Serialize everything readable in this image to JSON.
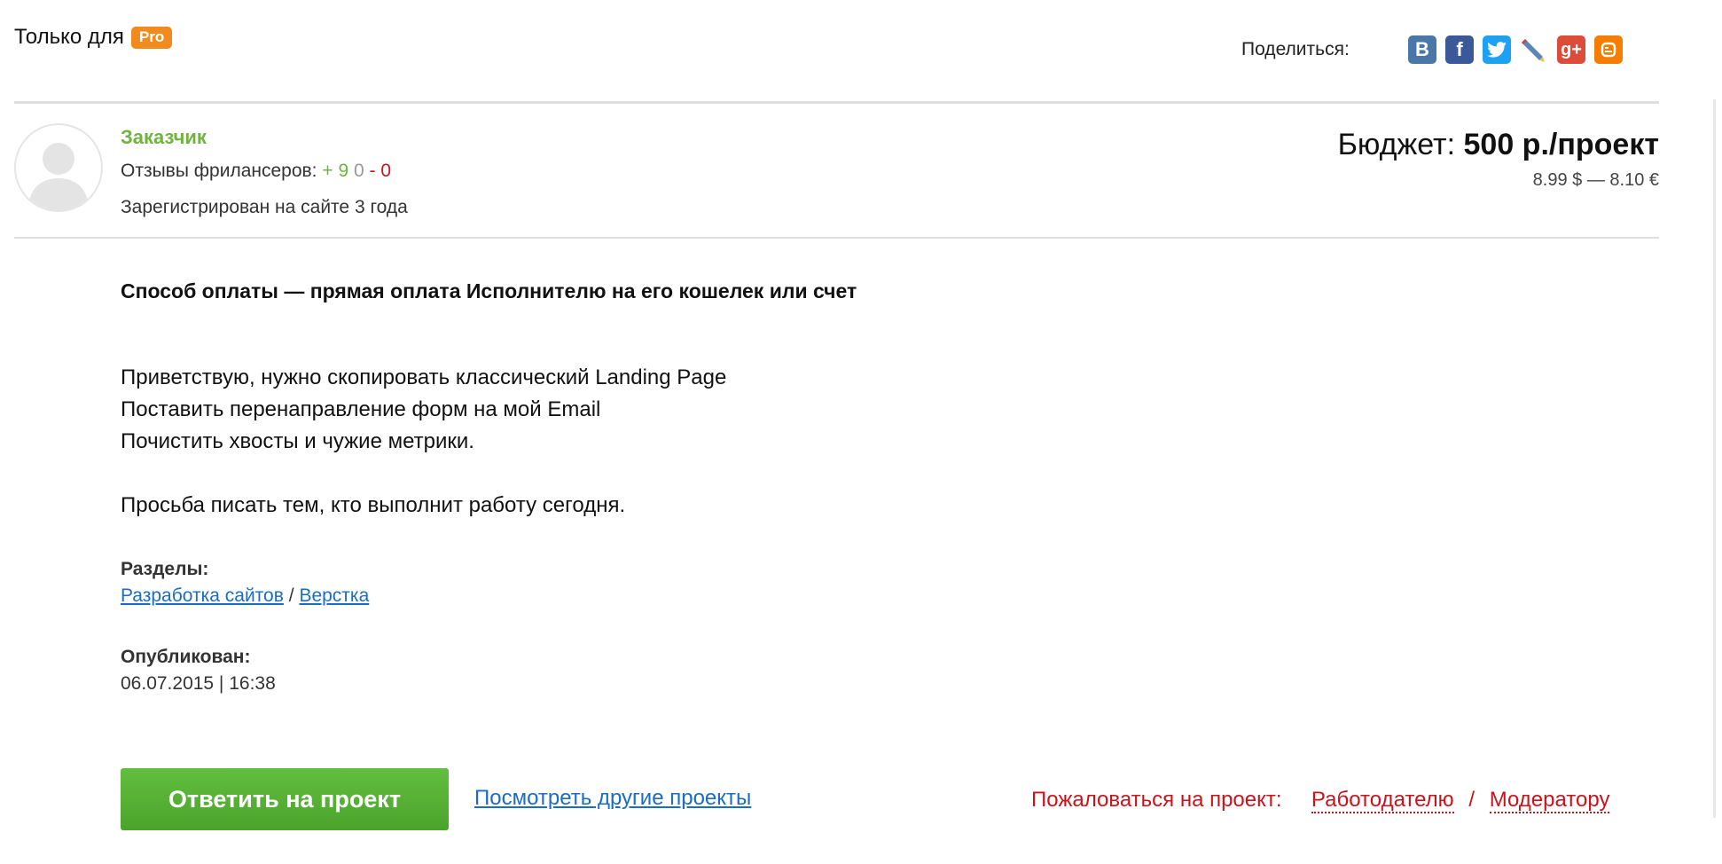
{
  "header": {
    "only_for": "Только для",
    "pro_badge": "Pro",
    "share_label": "Поделиться:",
    "share_icons": [
      "vk-icon",
      "facebook-icon",
      "twitter-icon",
      "livejournal-icon",
      "google-plus-icon",
      "blogger-icon"
    ]
  },
  "customer": {
    "role": "Заказчик",
    "reviews_label": "Отзывы фрилансеров:",
    "reviews_plus": "+ 9",
    "reviews_zero": "0",
    "reviews_minus": "- 0",
    "registered": "Зарегистрирован на сайте 3 года"
  },
  "budget": {
    "label": "Бюджет:",
    "value": "500 р./проект",
    "converted": "8.99 $ — 8.10 €"
  },
  "payment": "Способ оплаты — прямая оплата Исполнителю на его кошелек или счет",
  "description": {
    "line1": "Приветствую, нужно скопировать классический Landing Page",
    "line2": "Поставить перенаправление форм на мой Email",
    "line3": "Почистить хвосты и чужие метрики.",
    "line4": "Просьба писать тем, кто выполнит работу сегодня."
  },
  "sections": {
    "label": "Разделы:",
    "link1": "Разработка сайтов",
    "separator": "/",
    "link2": "Верстка"
  },
  "published": {
    "label": "Опубликован:",
    "value": "06.07.2015 | 16:38"
  },
  "actions": {
    "reply": "Ответить на проект",
    "other_projects": "Посмотреть другие проекты",
    "complain_label": "Пожаловаться на проект:",
    "complain_employer": "Работодателю",
    "complain_separator": "/",
    "complain_moderator": "Модератору"
  },
  "colors": {
    "accent_green": "#6eb43f",
    "pro_orange": "#f28b1d",
    "link_blue": "#1a6dc1",
    "complain_red": "#c9141c"
  }
}
